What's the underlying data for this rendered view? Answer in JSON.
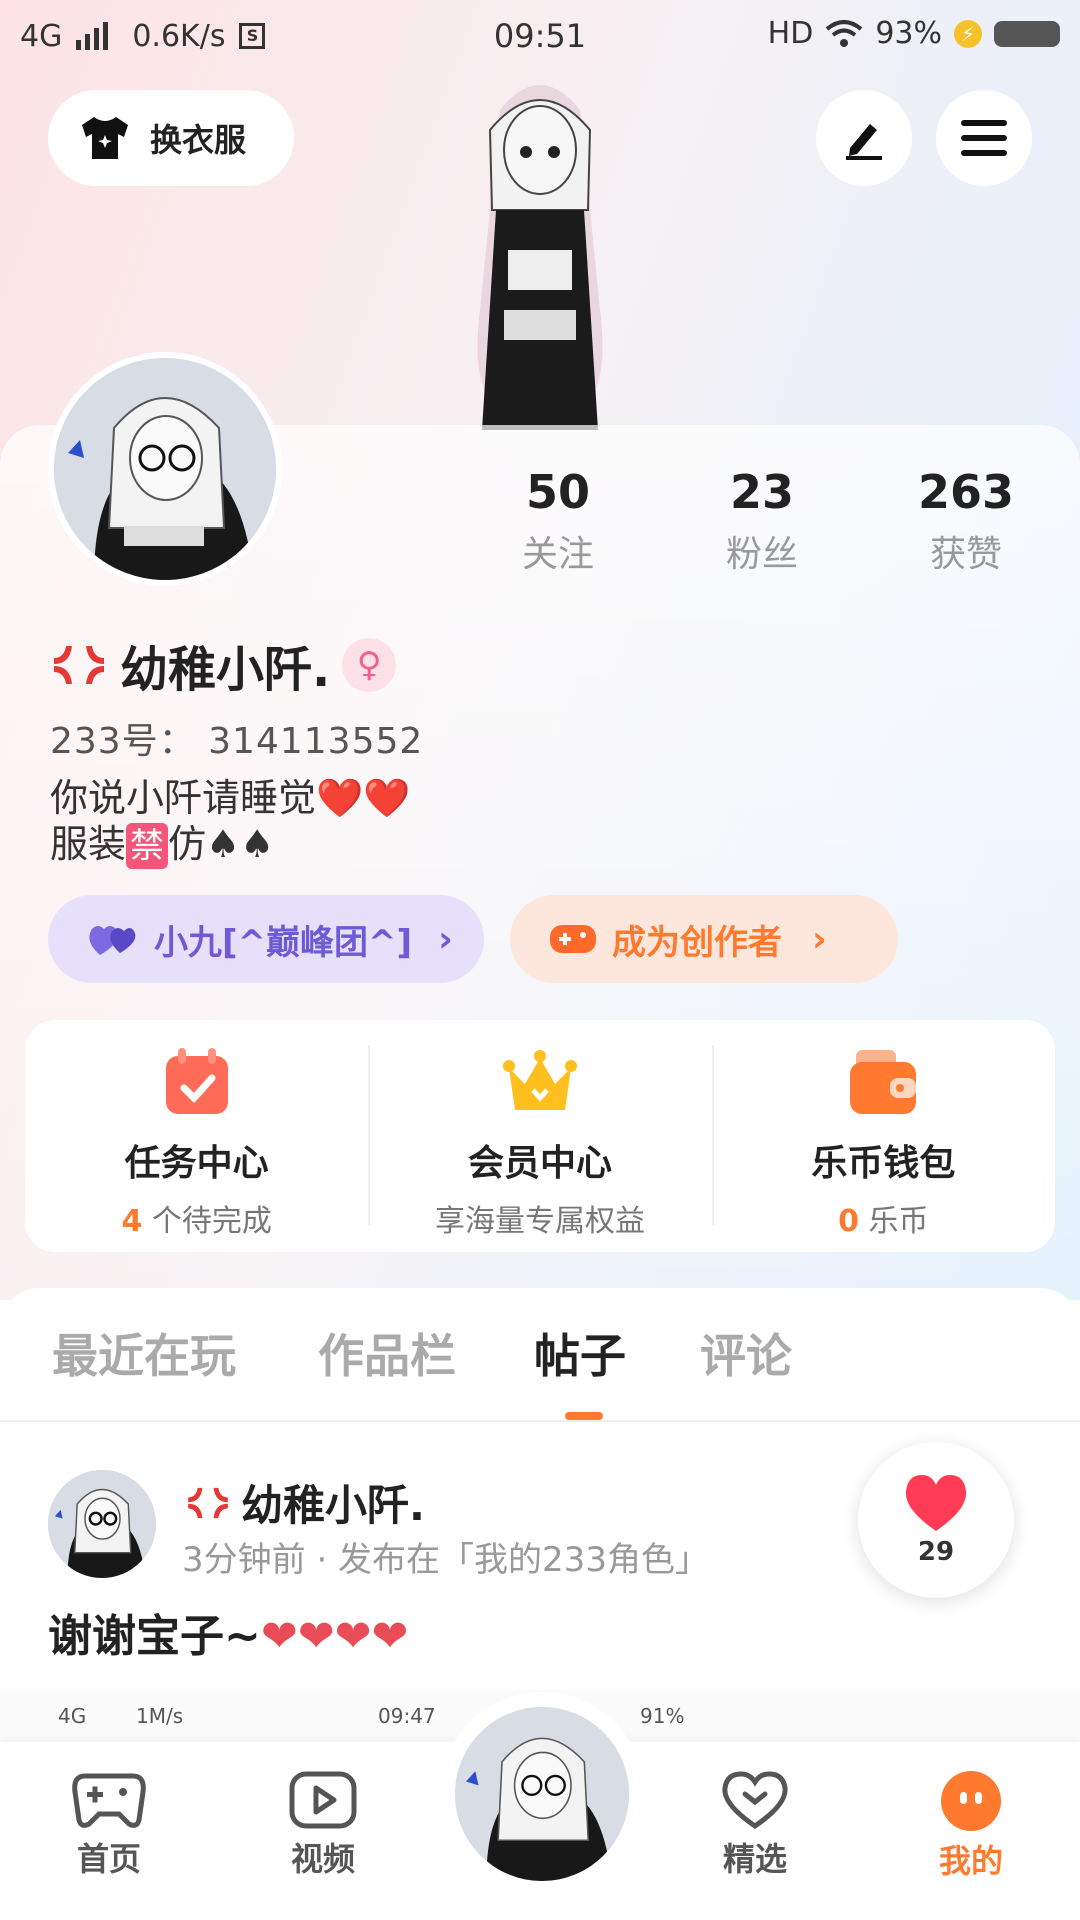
{
  "status": {
    "network": "4G",
    "speed": "0.6K/s",
    "sim_icon": "S",
    "time": "09:51",
    "hd": "HD",
    "battery": "93%"
  },
  "top": {
    "outfit_label": "换衣服"
  },
  "profile": {
    "following_count": "50",
    "following_label": "关注",
    "fans_count": "23",
    "fans_label": "粉丝",
    "likes_count": "263",
    "likes_label": "获赞",
    "name": "幼稚小阡.",
    "uid": "233号： 314113552",
    "bio_line1": "你说小阡请睡觉",
    "bio_line2_a": "服装",
    "bio_ban": "禁",
    "bio_line2_b": "仿",
    "hearts": "❤️❤️",
    "spades": "♠♠"
  },
  "pills": {
    "team": "小九[^巅峰团^]",
    "creator": "成为创作者"
  },
  "features": [
    {
      "title": "任务中心",
      "count": "4",
      "sub": "个待完成"
    },
    {
      "title": "会员中心",
      "sub": "享海量专属权益"
    },
    {
      "title": "乐币钱包",
      "count": "0",
      "sub": "乐币"
    }
  ],
  "tabs": [
    "最近在玩",
    "作品栏",
    "帖子",
    "评论"
  ],
  "post": {
    "author": "幼稚小阡.",
    "meta": "3分钟前 · 发布在「我的233角色」",
    "text": "谢谢宝子~",
    "hearts": "❤❤❤❤",
    "like_count": "29"
  },
  "thumb_status": {
    "network": "4G",
    "speed": "1M/s",
    "time": "09:47",
    "battery": "91%"
  },
  "nav": [
    "首页",
    "视频",
    "精选",
    "我的"
  ],
  "colors": {
    "accent": "#ff7a2f",
    "team_purple": "#6e5ad6"
  }
}
